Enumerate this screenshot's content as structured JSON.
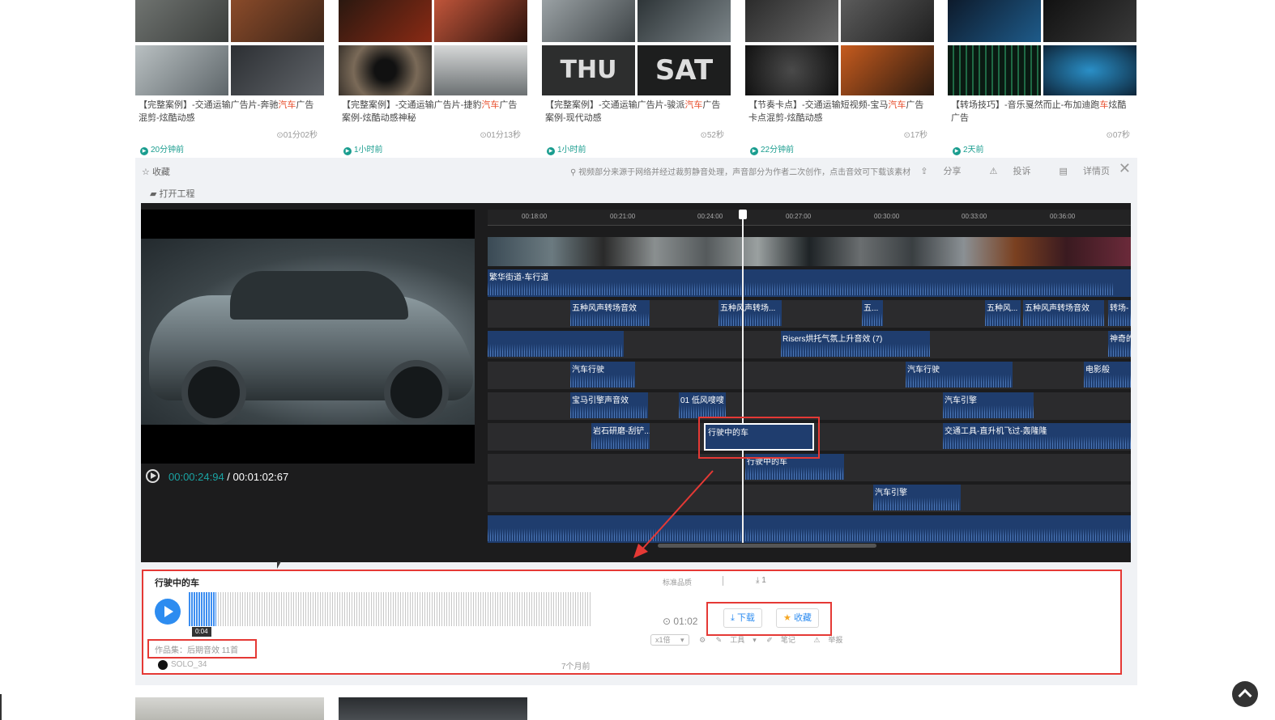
{
  "cards": [
    {
      "title_pre": "【完整案例】-交通运输广告片-奔驰",
      "title_hl": "汽车",
      "title_post": "广告混剪-炫酷动感",
      "duration": "01分02秒",
      "time_ago": "20分钟前"
    },
    {
      "title_pre": "【完整案例】-交通运输广告片-捷豹",
      "title_hl": "汽车",
      "title_post": "广告案例-炫酷动感神秘",
      "duration": "01分13秒",
      "time_ago": "1小时前"
    },
    {
      "title_pre": "【完整案例】-交通运输广告片-骏派",
      "title_hl": "汽车",
      "title_post": "广告案例-现代动感",
      "duration": "52秒",
      "time_ago": "1小时前"
    },
    {
      "title_pre": "【节奏卡点】-交通运输短视频-宝马",
      "title_hl": "汽车",
      "title_post": "广告卡点混剪-炫酷动感",
      "duration": "17秒",
      "time_ago": "22分钟前"
    },
    {
      "title_pre": "【转场技巧】-音乐戛然而止-布加迪跑",
      "title_hl": "车",
      "title_post": "炫酷广告",
      "duration": "07秒",
      "time_ago": "2天前"
    }
  ],
  "detail": {
    "favorite": "收藏",
    "open_project": "打开工程",
    "notice": "视频部分来源于网络并经过裁剪静音处理，声音部分为作者二次创作，点击音效可下载该素材",
    "share": "分享",
    "report": "投诉",
    "detail_page": "详情页",
    "close": "✕"
  },
  "player": {
    "current_time": "00:00:24:94",
    "separator": " / ",
    "total_time": "00:01:02:67"
  },
  "ruler_ticks": [
    "00:18:00",
    "00:21:00",
    "00:24:00",
    "00:27:00",
    "00:30:00",
    "00:33:00",
    "00:36:00"
  ],
  "tracks": [
    {
      "clips": [
        {
          "label": "繁华街道-车行道"
        }
      ]
    },
    {
      "clips": [
        {
          "label": "五种风声转场音效"
        },
        {
          "label": "五种风声转场..."
        },
        {
          "label": "五..."
        },
        {
          "label": "五种风..."
        },
        {
          "label": "五种风声转场音效"
        },
        {
          "label": "转场-"
        }
      ]
    },
    {
      "clips": [
        {
          "label": ""
        },
        {
          "label": "Risers烘托气氛上升音效 (7)"
        },
        {
          "label": "神奇的"
        }
      ]
    },
    {
      "clips": [
        {
          "label": "汽车行驶"
        },
        {
          "label": "汽车行驶"
        },
        {
          "label": "电影般"
        }
      ]
    },
    {
      "clips": [
        {
          "label": "宝马引擎声音效"
        },
        {
          "label": "01 低风嗖嗖"
        },
        {
          "label": "汽车引擎"
        }
      ]
    },
    {
      "clips": [
        {
          "label": "岩石研磨-刮铲..."
        },
        {
          "label": "交通工具-直升机飞过-轰隆隆"
        }
      ]
    },
    {
      "clips": [
        {
          "label": "行驶中的车"
        }
      ]
    },
    {
      "clips": [
        {
          "label": "汽车引擎"
        }
      ]
    },
    {
      "clips": [
        {
          "label": ""
        }
      ]
    }
  ],
  "selected_clip": "行驶中的车",
  "result": {
    "title": "行驶中的车",
    "position": "0:04",
    "album": "作品集：后期音效 11首",
    "author": "SOLO_34",
    "ago": "7个月前",
    "quality": "标准品质",
    "downloads": "1",
    "duration": "01:02",
    "download_btn": "下载",
    "favorite_btn": "收藏",
    "speed": "x1倍",
    "tool": "工具",
    "note": "笔记",
    "report": "举报"
  },
  "colors": {
    "accent": "#2d8cf0",
    "highlight": "#e53935",
    "clip": "#1f3d6e",
    "time_green": "#1a9d8f"
  }
}
